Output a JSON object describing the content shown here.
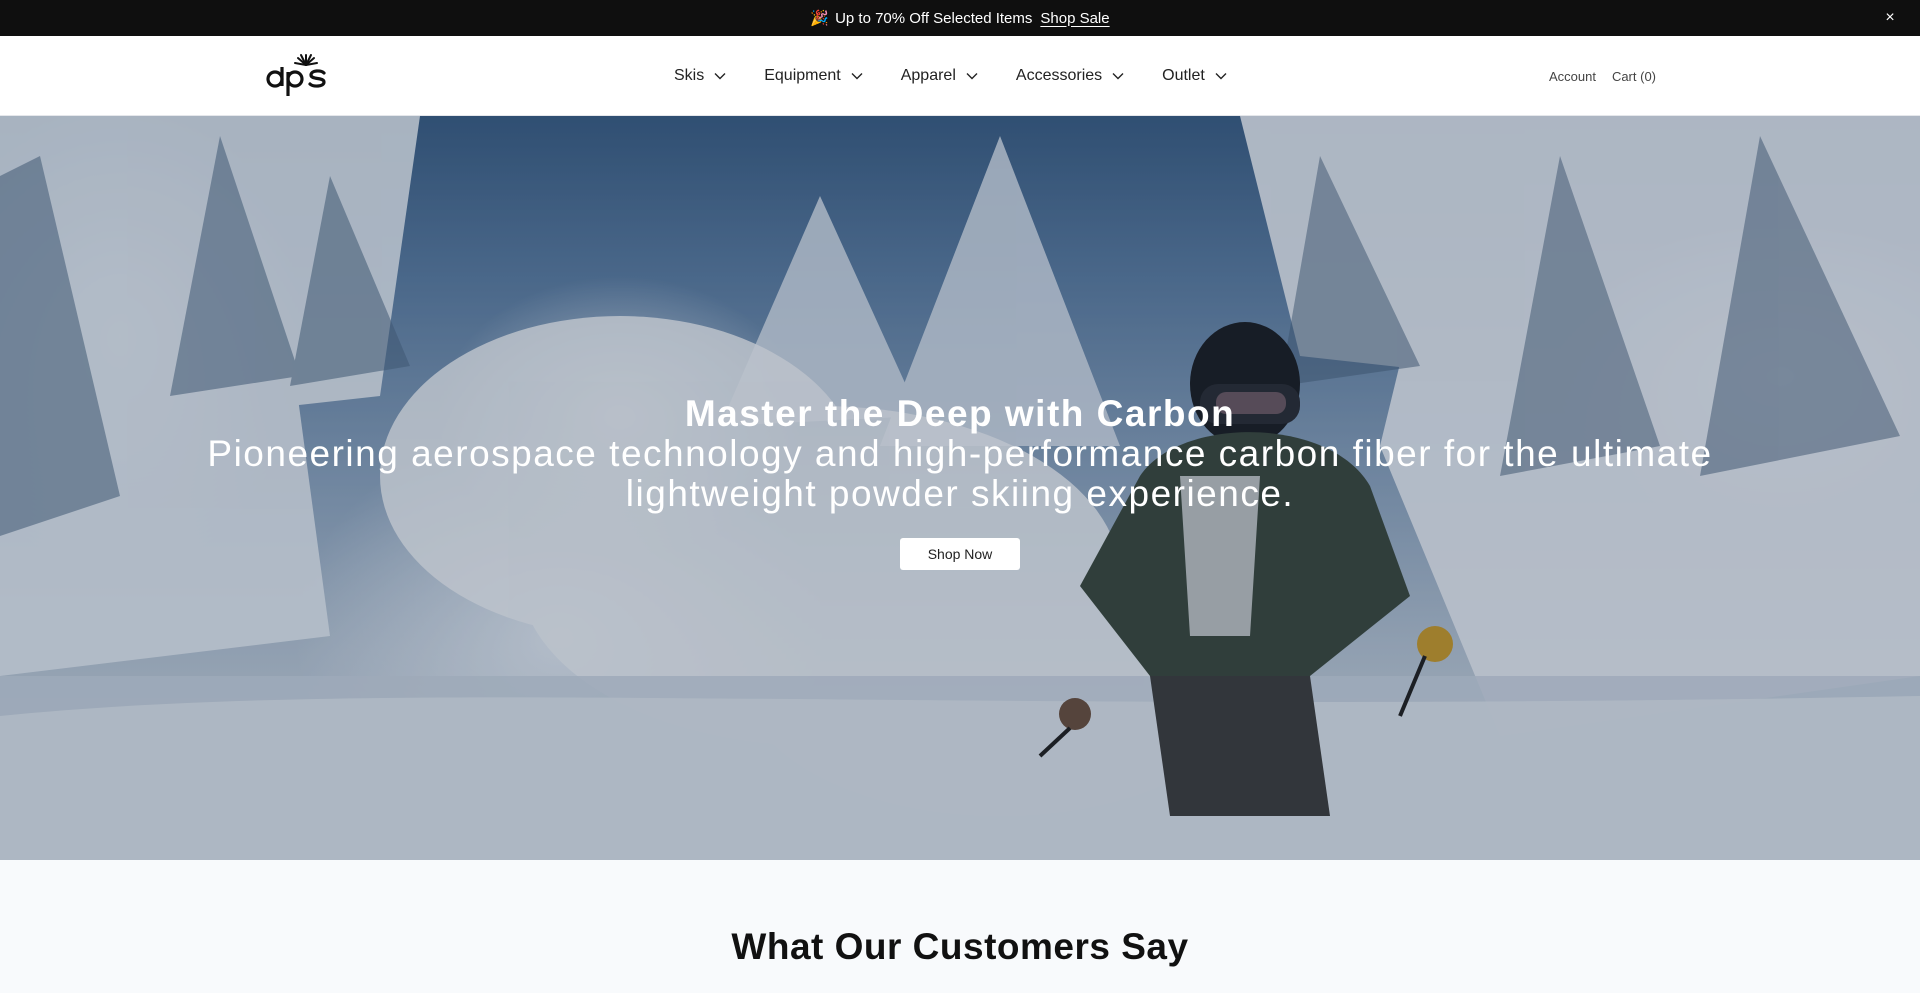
{
  "announcement": {
    "emoji": "🎉",
    "text": "Up to 70% Off Selected Items",
    "link": "Shop Sale",
    "close": "×"
  },
  "header": {
    "logo_text": "dps",
    "nav": [
      {
        "label": "Skis"
      },
      {
        "label": "Equipment"
      },
      {
        "label": "Apparel"
      },
      {
        "label": "Accessories"
      },
      {
        "label": "Outlet"
      }
    ],
    "account": "Account",
    "cart": "Cart (0)"
  },
  "hero": {
    "title": "Master the Deep with Carbon",
    "subtitle": "Pioneering aerospace technology and high-performance carbon fiber for the ultimate lightweight powder skiing experience.",
    "cta": "Shop Now"
  },
  "testimonials": {
    "title": "What Our Customers Say"
  },
  "colors": {
    "announcement_bg": "#0f0f0f",
    "header_bg": "#ffffff",
    "page_bg": "#f8fafc",
    "button_bg": "#ffffff"
  },
  "icons": {
    "nav_dropdown": "chevron-down-icon",
    "close": "close-icon",
    "announcement": "party-popper-icon"
  }
}
